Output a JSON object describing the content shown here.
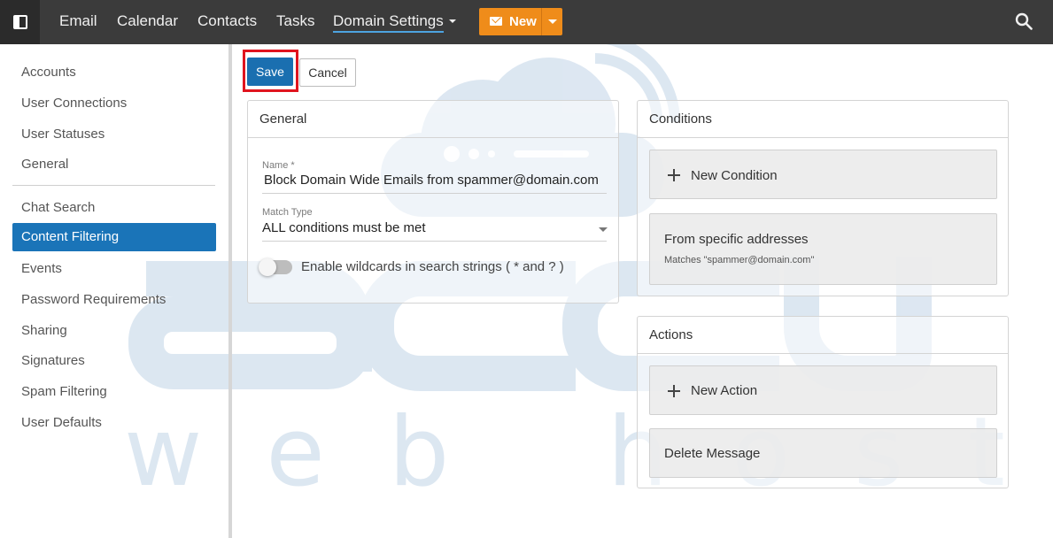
{
  "topnav": {
    "items": [
      "Email",
      "Calendar",
      "Contacts",
      "Tasks",
      "Domain Settings"
    ],
    "active": "Domain Settings",
    "new_button": "New"
  },
  "sidebar": {
    "group1": [
      "Accounts",
      "User Connections",
      "User Statuses",
      "General"
    ],
    "group2": [
      "Chat Search",
      "Content Filtering",
      "Events",
      "Password Requirements",
      "Sharing",
      "Signatures",
      "Spam Filtering",
      "User Defaults"
    ],
    "active": "Content Filtering"
  },
  "toolbar": {
    "save_label": "Save",
    "cancel_label": "Cancel"
  },
  "general": {
    "title": "General",
    "name_label": "Name *",
    "name_value": "Block Domain Wide Emails from spammer@domain.com",
    "match_label": "Match Type",
    "match_value": "ALL conditions must be met",
    "wildcard_label": "Enable wildcards in search strings ( * and ? )",
    "wildcard_enabled": false
  },
  "conditions": {
    "title": "Conditions",
    "new_label": "New Condition",
    "items": [
      {
        "title": "From specific addresses",
        "detail": "Matches \"spammer@domain.com\""
      }
    ]
  },
  "actions": {
    "title": "Actions",
    "new_label": "New Action",
    "items": [
      "Delete Message"
    ]
  },
  "colors": {
    "accent": "#1a74b8",
    "new_button": "#ef8c1a",
    "highlight": "#e0141e",
    "watermark": "#dbe6f1"
  },
  "icons": {
    "sidebar_toggle": "sidebar-toggle-icon",
    "search": "search-icon",
    "new": "envelope-icon",
    "add": "plus-icon"
  }
}
